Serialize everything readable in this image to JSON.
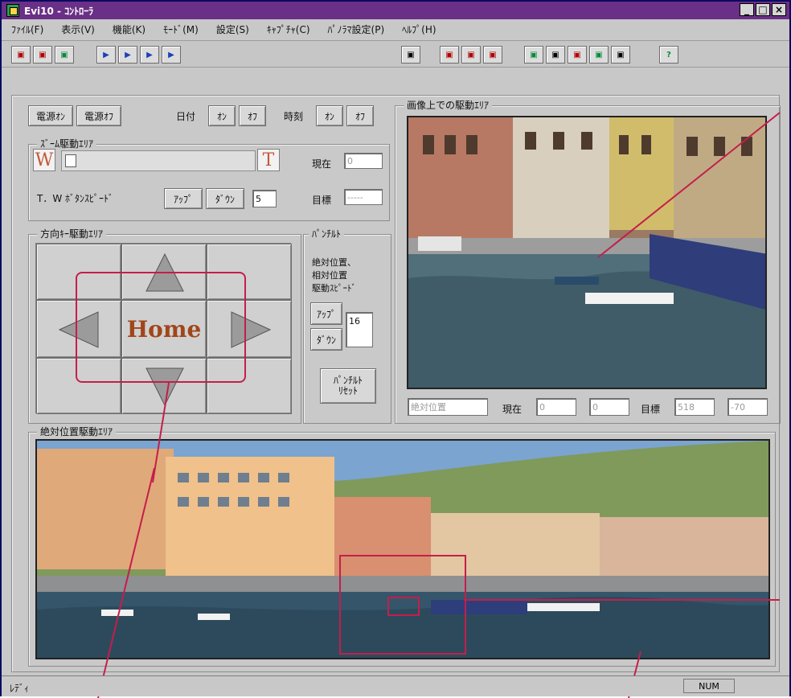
{
  "window": {
    "title": "Evi10 - ｺﾝﾄﾛｰﾗ",
    "controls": [
      "_",
      "□",
      "×"
    ]
  },
  "menu": [
    "ﾌｧｲﾙ(F)",
    "表示(V)",
    "機能(K)",
    "ﾓｰﾄﾞ(M)",
    "設定(S)",
    "ｷｬﾌﾟﾁｬ(C)",
    "ﾊﾟﾉﾗﾏ設定(P)",
    "ﾍﾙﾌﾟ(H)"
  ],
  "toolbar": {
    "left_buttons": [
      "▣",
      "▣",
      "▣",
      "▶",
      "▶",
      "▶",
      "▶"
    ],
    "right_buttons": [
      "▣",
      "▣",
      "▣",
      "▣",
      "▣",
      "▣",
      "▣",
      "▣",
      "▣",
      "?"
    ]
  },
  "power": {
    "on": "電源ｵﾝ",
    "off": "電源ｵﾌ"
  },
  "date": {
    "label": "日付",
    "on": "ｵﾝ",
    "off": "ｵﾌ"
  },
  "time": {
    "label": "時刻",
    "on": "ｵﾝ",
    "off": "ｵﾌ"
  },
  "zoom_area": {
    "title": "ｽﾞｰﾑ駆動ｴﾘｱ",
    "w": "W",
    "t": "T",
    "current_label": "現在",
    "current_value": "0",
    "tw_speed_label": "T．W ﾎﾞﾀﾝｽﾋﾟｰﾄﾞ",
    "up": "ｱｯﾌﾟ",
    "down": "ﾀﾞｳﾝ",
    "speed_value": "5",
    "target_label": "目標",
    "target_value": "-----"
  },
  "direction_area": {
    "title": "方向ｷｰ駆動ｴﾘｱ",
    "home": "Home"
  },
  "pan_tilt": {
    "title": "ﾊﾟﾝﾁﾙﾄ",
    "desc1": "絶対位置、",
    "desc2": "相対位置",
    "desc3": "駆動ｽﾋﾟｰﾄﾞ",
    "up": "ｱｯﾌﾟ",
    "down": "ﾀﾞｳﾝ",
    "value": "16",
    "reset_line1": "ﾊﾟﾝﾁﾙﾄ",
    "reset_line2": "ﾘｾｯﾄ"
  },
  "image_area": {
    "title": "画像上での駆動ｴﾘｱ"
  },
  "position_row": {
    "abs_label": "絶対位置",
    "current_label": "現在",
    "current_x": "0",
    "current_y": "0",
    "target_label": "目標",
    "target_x": "518",
    "target_y": "-70"
  },
  "panorama": {
    "title": "絶対位置駆動ｴﾘｱ"
  },
  "status": {
    "left": "ﾚﾃﾞｨ",
    "num": "NUM"
  }
}
